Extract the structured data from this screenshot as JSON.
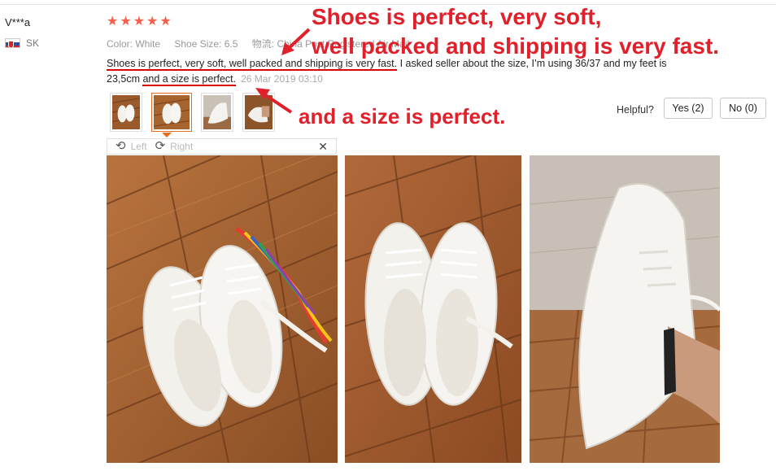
{
  "reviewer": {
    "name": "V***a",
    "country": "SK"
  },
  "rating": {
    "stars": 5
  },
  "attributes": {
    "color": "Color: White",
    "shoe_size": "Shoe Size: 6.5",
    "logistics": "物流: China Post Registered Air Mail"
  },
  "review": {
    "part1": "Shoes is perfect, very soft, well packed and shipping is very fast.",
    "part2": " I asked seller about the size, I’m using 36/37 and my feet is 23,5cm ",
    "part3": "and a size is perfect.",
    "date": "26 Mar 2019 03:10"
  },
  "thumbnails": {
    "count": 4,
    "selected_index": 1
  },
  "rotate": {
    "left_label": "Left",
    "right_label": "Right",
    "close_glyph": "✕"
  },
  "helpful": {
    "label": "Helpful?",
    "yes_label": "Yes (2)",
    "no_label": "No (0)"
  },
  "annotations": {
    "line1": "Shoes is perfect, very soft,",
    "line2": "well packed and shipping is very fast.",
    "line3": "and a size is perfect."
  },
  "icons": {
    "star": "star-icon",
    "rotate_left": "rotate-left-icon",
    "rotate_right": "rotate-right-icon",
    "close": "close-icon",
    "flag": "slovakia-flag-icon"
  },
  "colors": {
    "star": "#f5604a",
    "annotation": "#e0202a",
    "accent_border": "#e46d1f",
    "wood_light": "#b8743f",
    "wood_dark": "#7a4420"
  }
}
